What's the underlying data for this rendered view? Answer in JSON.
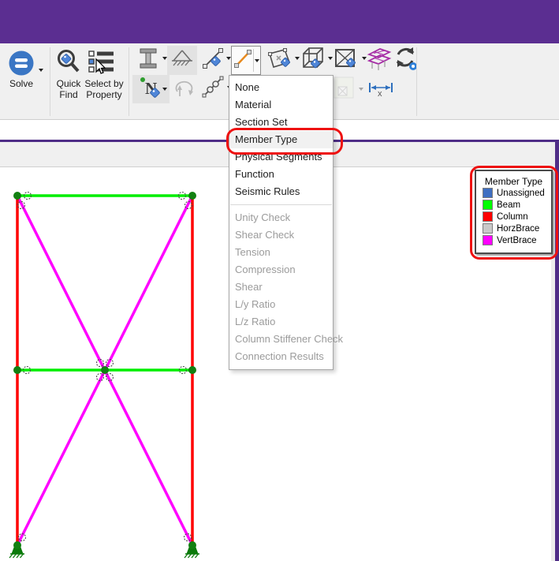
{
  "colors": {
    "titlebar": "#5b2e91",
    "panel_border": "#4f2d87",
    "annotation": "#ee1111",
    "beam": "#00ee00",
    "column": "#ff0000",
    "vert_brace": "#ff00ff",
    "node": "#128012",
    "support": "#0b7a0b"
  },
  "ribbon": {
    "solve_label": "Solve",
    "quick_find_label": "Quick Find",
    "select_by_property_label": "Select by Property"
  },
  "dimension_tool": {
    "axis_label": "x"
  },
  "menu": {
    "items": [
      {
        "label": "None",
        "enabled": true
      },
      {
        "label": "Material",
        "enabled": true
      },
      {
        "label": "Section Set",
        "enabled": true
      },
      {
        "label": "Member Type",
        "enabled": true,
        "highlighted": true
      },
      {
        "label": "Physical Segments",
        "enabled": true
      },
      {
        "label": "Function",
        "enabled": true
      },
      {
        "label": "Seismic Rules",
        "enabled": true
      },
      {
        "label": "Unity Check",
        "enabled": false
      },
      {
        "label": "Shear Check",
        "enabled": false
      },
      {
        "label": "Tension",
        "enabled": false
      },
      {
        "label": "Compression",
        "enabled": false
      },
      {
        "label": "Shear",
        "enabled": false
      },
      {
        "label": "L/y Ratio",
        "enabled": false
      },
      {
        "label": "L/z Ratio",
        "enabled": false
      },
      {
        "label": "Column Stiffener Check",
        "enabled": false
      },
      {
        "label": "Connection Results",
        "enabled": false
      }
    ]
  },
  "legend": {
    "title": "Member Type",
    "entries": [
      {
        "label": "Unassigned",
        "color": "#3f6fc1"
      },
      {
        "label": "Beam",
        "color": "#00ff00"
      },
      {
        "label": "Column",
        "color": "#ff0000"
      },
      {
        "label": "HorzBrace",
        "color": "#c9c9c9"
      },
      {
        "label": "VertBrace",
        "color": "#ff00ff"
      }
    ]
  }
}
